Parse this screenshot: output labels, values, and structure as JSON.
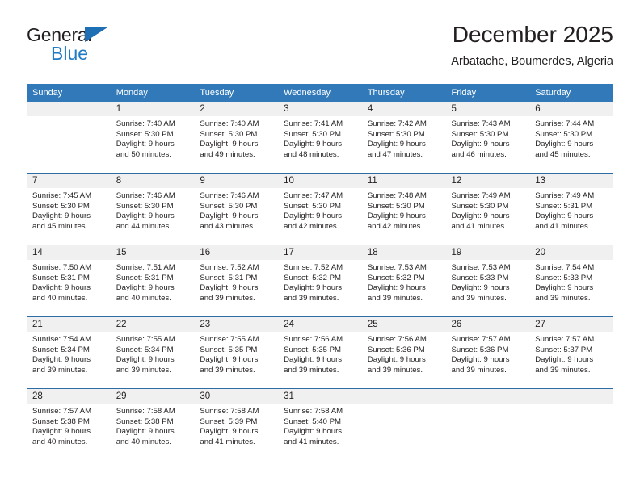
{
  "brand": {
    "name_top": "General",
    "name_bottom": "Blue",
    "icon": "triangle-logo-icon",
    "color_dark": "#231f20",
    "color_blue": "#1f7bc4"
  },
  "header": {
    "title": "December 2025",
    "subtitle": "Arbatache, Boumerdes, Algeria"
  },
  "theme": {
    "header_blue": "#3179b9",
    "row_divider_blue": "#2e6da4",
    "daynum_strip_gray": "#f0f0f0"
  },
  "calendar": {
    "weekday_headers": [
      "Sunday",
      "Monday",
      "Tuesday",
      "Wednesday",
      "Thursday",
      "Friday",
      "Saturday"
    ],
    "weeks": [
      [
        {
          "day": "",
          "lines": []
        },
        {
          "day": "1",
          "lines": [
            "Sunrise: 7:40 AM",
            "Sunset: 5:30 PM",
            "Daylight: 9 hours",
            "and 50 minutes."
          ]
        },
        {
          "day": "2",
          "lines": [
            "Sunrise: 7:40 AM",
            "Sunset: 5:30 PM",
            "Daylight: 9 hours",
            "and 49 minutes."
          ]
        },
        {
          "day": "3",
          "lines": [
            "Sunrise: 7:41 AM",
            "Sunset: 5:30 PM",
            "Daylight: 9 hours",
            "and 48 minutes."
          ]
        },
        {
          "day": "4",
          "lines": [
            "Sunrise: 7:42 AM",
            "Sunset: 5:30 PM",
            "Daylight: 9 hours",
            "and 47 minutes."
          ]
        },
        {
          "day": "5",
          "lines": [
            "Sunrise: 7:43 AM",
            "Sunset: 5:30 PM",
            "Daylight: 9 hours",
            "and 46 minutes."
          ]
        },
        {
          "day": "6",
          "lines": [
            "Sunrise: 7:44 AM",
            "Sunset: 5:30 PM",
            "Daylight: 9 hours",
            "and 45 minutes."
          ]
        }
      ],
      [
        {
          "day": "7",
          "lines": [
            "Sunrise: 7:45 AM",
            "Sunset: 5:30 PM",
            "Daylight: 9 hours",
            "and 45 minutes."
          ]
        },
        {
          "day": "8",
          "lines": [
            "Sunrise: 7:46 AM",
            "Sunset: 5:30 PM",
            "Daylight: 9 hours",
            "and 44 minutes."
          ]
        },
        {
          "day": "9",
          "lines": [
            "Sunrise: 7:46 AM",
            "Sunset: 5:30 PM",
            "Daylight: 9 hours",
            "and 43 minutes."
          ]
        },
        {
          "day": "10",
          "lines": [
            "Sunrise: 7:47 AM",
            "Sunset: 5:30 PM",
            "Daylight: 9 hours",
            "and 42 minutes."
          ]
        },
        {
          "day": "11",
          "lines": [
            "Sunrise: 7:48 AM",
            "Sunset: 5:30 PM",
            "Daylight: 9 hours",
            "and 42 minutes."
          ]
        },
        {
          "day": "12",
          "lines": [
            "Sunrise: 7:49 AM",
            "Sunset: 5:30 PM",
            "Daylight: 9 hours",
            "and 41 minutes."
          ]
        },
        {
          "day": "13",
          "lines": [
            "Sunrise: 7:49 AM",
            "Sunset: 5:31 PM",
            "Daylight: 9 hours",
            "and 41 minutes."
          ]
        }
      ],
      [
        {
          "day": "14",
          "lines": [
            "Sunrise: 7:50 AM",
            "Sunset: 5:31 PM",
            "Daylight: 9 hours",
            "and 40 minutes."
          ]
        },
        {
          "day": "15",
          "lines": [
            "Sunrise: 7:51 AM",
            "Sunset: 5:31 PM",
            "Daylight: 9 hours",
            "and 40 minutes."
          ]
        },
        {
          "day": "16",
          "lines": [
            "Sunrise: 7:52 AM",
            "Sunset: 5:31 PM",
            "Daylight: 9 hours",
            "and 39 minutes."
          ]
        },
        {
          "day": "17",
          "lines": [
            "Sunrise: 7:52 AM",
            "Sunset: 5:32 PM",
            "Daylight: 9 hours",
            "and 39 minutes."
          ]
        },
        {
          "day": "18",
          "lines": [
            "Sunrise: 7:53 AM",
            "Sunset: 5:32 PM",
            "Daylight: 9 hours",
            "and 39 minutes."
          ]
        },
        {
          "day": "19",
          "lines": [
            "Sunrise: 7:53 AM",
            "Sunset: 5:33 PM",
            "Daylight: 9 hours",
            "and 39 minutes."
          ]
        },
        {
          "day": "20",
          "lines": [
            "Sunrise: 7:54 AM",
            "Sunset: 5:33 PM",
            "Daylight: 9 hours",
            "and 39 minutes."
          ]
        }
      ],
      [
        {
          "day": "21",
          "lines": [
            "Sunrise: 7:54 AM",
            "Sunset: 5:34 PM",
            "Daylight: 9 hours",
            "and 39 minutes."
          ]
        },
        {
          "day": "22",
          "lines": [
            "Sunrise: 7:55 AM",
            "Sunset: 5:34 PM",
            "Daylight: 9 hours",
            "and 39 minutes."
          ]
        },
        {
          "day": "23",
          "lines": [
            "Sunrise: 7:55 AM",
            "Sunset: 5:35 PM",
            "Daylight: 9 hours",
            "and 39 minutes."
          ]
        },
        {
          "day": "24",
          "lines": [
            "Sunrise: 7:56 AM",
            "Sunset: 5:35 PM",
            "Daylight: 9 hours",
            "and 39 minutes."
          ]
        },
        {
          "day": "25",
          "lines": [
            "Sunrise: 7:56 AM",
            "Sunset: 5:36 PM",
            "Daylight: 9 hours",
            "and 39 minutes."
          ]
        },
        {
          "day": "26",
          "lines": [
            "Sunrise: 7:57 AM",
            "Sunset: 5:36 PM",
            "Daylight: 9 hours",
            "and 39 minutes."
          ]
        },
        {
          "day": "27",
          "lines": [
            "Sunrise: 7:57 AM",
            "Sunset: 5:37 PM",
            "Daylight: 9 hours",
            "and 39 minutes."
          ]
        }
      ],
      [
        {
          "day": "28",
          "lines": [
            "Sunrise: 7:57 AM",
            "Sunset: 5:38 PM",
            "Daylight: 9 hours",
            "and 40 minutes."
          ]
        },
        {
          "day": "29",
          "lines": [
            "Sunrise: 7:58 AM",
            "Sunset: 5:38 PM",
            "Daylight: 9 hours",
            "and 40 minutes."
          ]
        },
        {
          "day": "30",
          "lines": [
            "Sunrise: 7:58 AM",
            "Sunset: 5:39 PM",
            "Daylight: 9 hours",
            "and 41 minutes."
          ]
        },
        {
          "day": "31",
          "lines": [
            "Sunrise: 7:58 AM",
            "Sunset: 5:40 PM",
            "Daylight: 9 hours",
            "and 41 minutes."
          ]
        },
        {
          "day": "",
          "lines": []
        },
        {
          "day": "",
          "lines": []
        },
        {
          "day": "",
          "lines": []
        }
      ]
    ]
  }
}
